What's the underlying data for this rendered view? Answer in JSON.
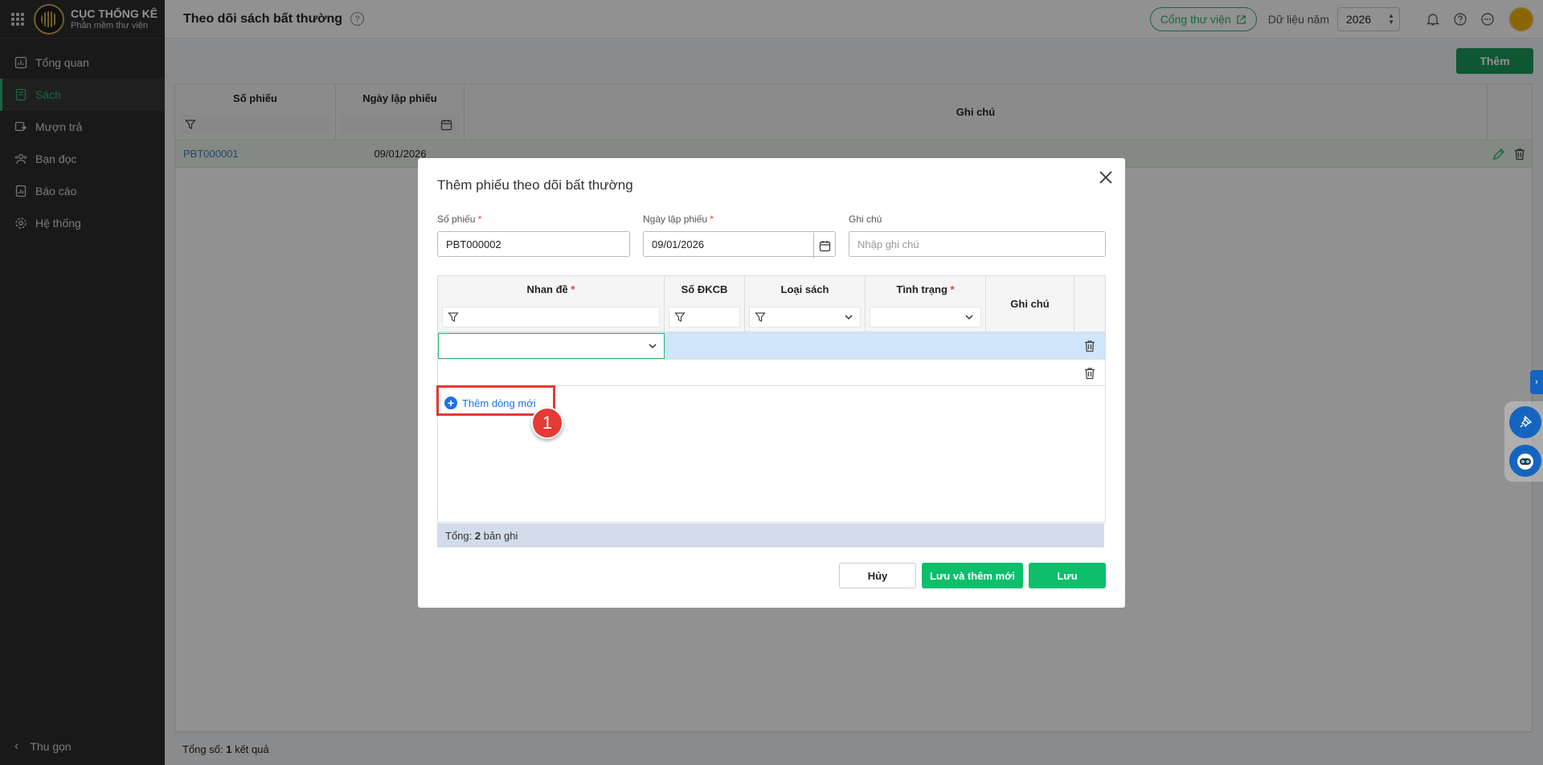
{
  "app": {
    "brand_title": "CỤC THỐNG KÊ",
    "brand_subtitle": "Phần mềm thư viện",
    "page_title": "Theo dõi sách bất thường",
    "portal_label": "Cổng thư viện",
    "year_label": "Dữ liệu năm",
    "year_value": "2026"
  },
  "sidebar": {
    "items": [
      {
        "label": "Tổng quan",
        "icon": "chart-icon"
      },
      {
        "label": "Sách",
        "icon": "book-icon"
      },
      {
        "label": "Mượn trả",
        "icon": "transfer-icon"
      },
      {
        "label": "Bạn đọc",
        "icon": "users-icon"
      },
      {
        "label": "Báo cáo",
        "icon": "report-icon"
      },
      {
        "label": "Hệ thống",
        "icon": "gear-icon"
      }
    ],
    "collapse_label": "Thu gọn"
  },
  "main": {
    "add_button": "Thêm",
    "columns": [
      "Số phiếu",
      "Ngày lập phiếu",
      "Ghi chú"
    ],
    "rows": [
      {
        "so_phieu": "PBT000001",
        "ngay": "09/01/2026",
        "ghi_chu": ""
      }
    ],
    "total_prefix": "Tổng số:",
    "total_count": "1",
    "total_suffix": "kết quả"
  },
  "modal": {
    "title": "Thêm phiếu theo dõi bất thường",
    "fields": {
      "so_phieu_label": "Số phiếu",
      "so_phieu_value": "PBT000002",
      "ngay_label": "Ngày lập phiếu",
      "ngay_value": "09/01/2026",
      "ghi_chu_label": "Ghi chú",
      "ghi_chu_placeholder": "Nhập ghi chú"
    },
    "required_mark": "*",
    "detail_columns": [
      "Nhan đề",
      "Số ĐKCB",
      "Loại sách",
      "Tình trạng",
      "Ghi chú"
    ],
    "add_line_label": "Thêm dòng mới",
    "step_badge": "1",
    "footer_prefix": "Tổng:",
    "footer_count": "2",
    "footer_suffix": "bản ghi",
    "cancel_label": "Hủy",
    "save_new_label": "Lưu và thêm mới",
    "save_label": "Lưu"
  },
  "colors": {
    "accent": "#2bb673",
    "sidebar_bg": "#2c2c2c",
    "highlight": "#e53935",
    "link": "#1a73e8"
  }
}
